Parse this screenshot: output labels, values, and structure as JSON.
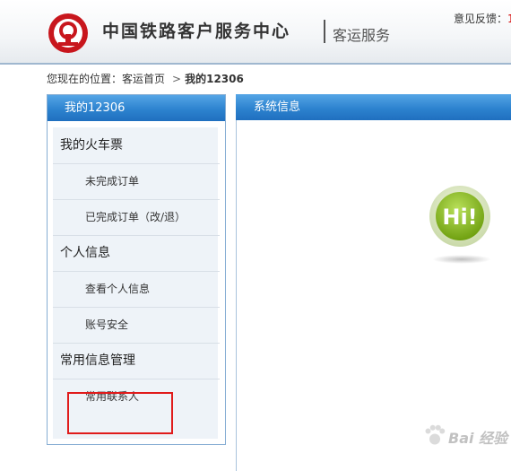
{
  "header": {
    "site_title": "中国铁路客户服务中心",
    "service_label": "客运服务",
    "feedback_label": "意见反馈：",
    "feedback_number": "1"
  },
  "breadcrumb": {
    "prefix": "您现在的位置：",
    "home": "客运首页",
    "separator": ">",
    "current": "我的12306"
  },
  "left_panel": {
    "title": "我的12306",
    "menu": [
      {
        "type": "section",
        "label": "我的火车票"
      },
      {
        "type": "item",
        "label": "未完成订单"
      },
      {
        "type": "item",
        "label": "已完成订单（改/退）"
      },
      {
        "type": "section",
        "label": "个人信息"
      },
      {
        "type": "item",
        "label": "查看个人信息"
      },
      {
        "type": "item",
        "label": "账号安全"
      },
      {
        "type": "section",
        "label": "常用信息管理"
      },
      {
        "type": "item",
        "label": "常用联系人"
      }
    ]
  },
  "right_panel": {
    "title": "系统信息",
    "badge_text": "Hi!"
  },
  "colors": {
    "header_blue": "#2d83cf",
    "highlight_red": "#e01b1b",
    "badge_green": "#8dc21f"
  },
  "watermark": "Bai 经验"
}
